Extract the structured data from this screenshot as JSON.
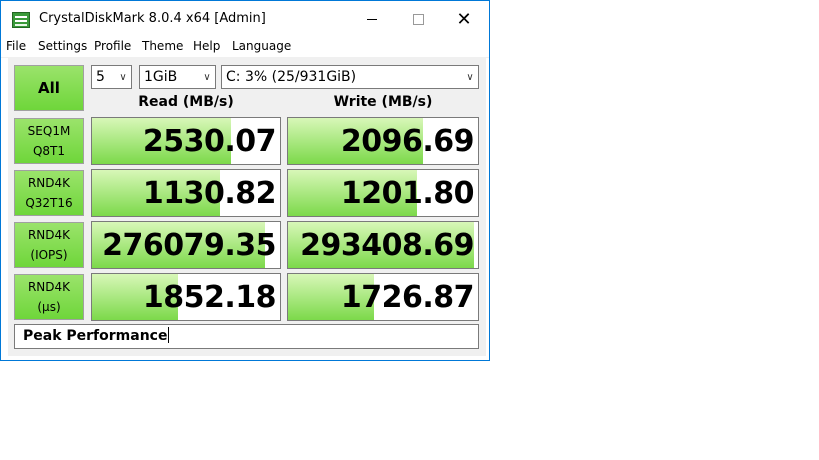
{
  "window": {
    "title": "CrystalDiskMark 8.0.4 x64 [Admin]",
    "accent": "#0078d7"
  },
  "menu": [
    "File",
    "Settings",
    "Profile",
    "Theme",
    "Help",
    "Language"
  ],
  "controls": {
    "all_label": "All",
    "test_count": "5",
    "test_size": "1GiB",
    "drive": "C: 3% (25/931GiB)"
  },
  "headers": {
    "read": "Read (MB/s)",
    "write": "Write (MB/s)"
  },
  "rows": [
    {
      "line1": "SEQ1M",
      "line2": "Q8T1",
      "read": "2530.07",
      "write": "2096.69",
      "read_fill": 0.74,
      "write_fill": 0.71
    },
    {
      "line1": "RND4K",
      "line2": "Q32T16",
      "read": "1130.82",
      "write": "1201.80",
      "read_fill": 0.68,
      "write_fill": 0.68
    },
    {
      "line1": "RND4K",
      "line2": "(IOPS)",
      "read": "276079.35",
      "write": "293408.69",
      "read_fill": 0.92,
      "write_fill": 0.98
    },
    {
      "line1": "RND4K",
      "line2": "(µs)",
      "read": "1852.18",
      "write": "1726.87",
      "read_fill": 0.46,
      "write_fill": 0.45
    }
  ],
  "comment": "Peak Performance",
  "colors": {
    "bar_green": "#7cd94a",
    "button_green": "#6fd63a",
    "panel_bg": "#f0f0f0"
  }
}
